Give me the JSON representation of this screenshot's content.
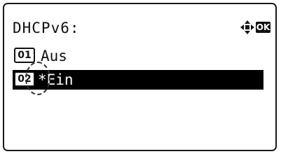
{
  "screen": {
    "title": "DHCPv6:",
    "ok_label": "OK",
    "nav_icon": "four-way-arrow-icon"
  },
  "options": [
    {
      "number": "01",
      "label": "Aus",
      "selected": false
    },
    {
      "number": "02",
      "label": "*Ein",
      "selected": true
    }
  ]
}
